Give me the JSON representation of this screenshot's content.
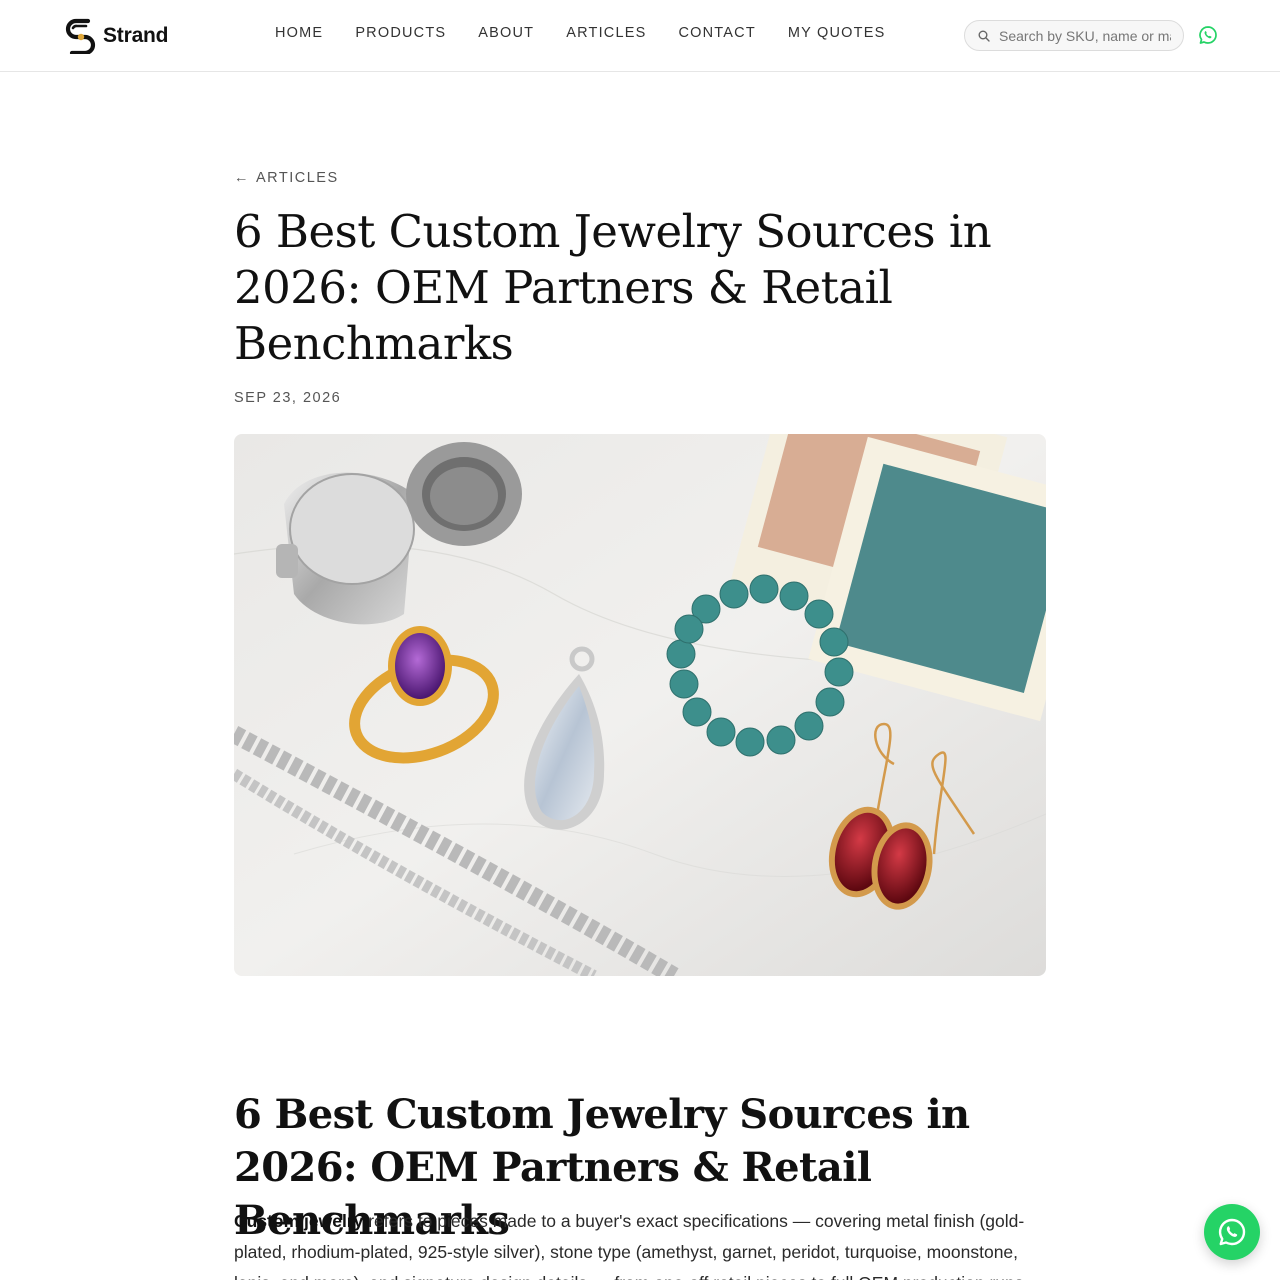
{
  "brand": {
    "name": "Strand"
  },
  "nav": {
    "items": [
      {
        "label": "HOME"
      },
      {
        "label": "PRODUCTS"
      },
      {
        "label": "ABOUT"
      },
      {
        "label": "ARTICLES"
      },
      {
        "label": "CONTACT"
      },
      {
        "label": "MY QUOTES"
      }
    ]
  },
  "search": {
    "placeholder": "Search by SKU, name or material"
  },
  "article": {
    "back_label": "ARTICLES",
    "back_arrow": "←",
    "title": "6 Best Custom Jewelry Sources in 2026: OEM Partners & Retail Benchmarks",
    "date": "SEP 23, 2026",
    "body_title": "6 Best Custom Jewelry Sources in 2026: OEM Partners & Retail Benchmarks",
    "intro_strong": "Custom jewelry",
    "intro_rest": " refers to pieces made to a buyer's exact specifications — covering metal finish (gold-plated, rhodium-plated, 925-style silver), stone type (amethyst, garnet, peridot, turquoise, moonstone, lapis, and more), and signature design details — from one-off retail pieces to full OEM production runs for brands and boutiques."
  },
  "colors": {
    "accent_whatsapp": "#25D366",
    "text_dark": "#111111",
    "border": "#e6e6e6"
  },
  "icons": [
    "strand-logo-icon",
    "search-icon",
    "whatsapp-icon"
  ]
}
